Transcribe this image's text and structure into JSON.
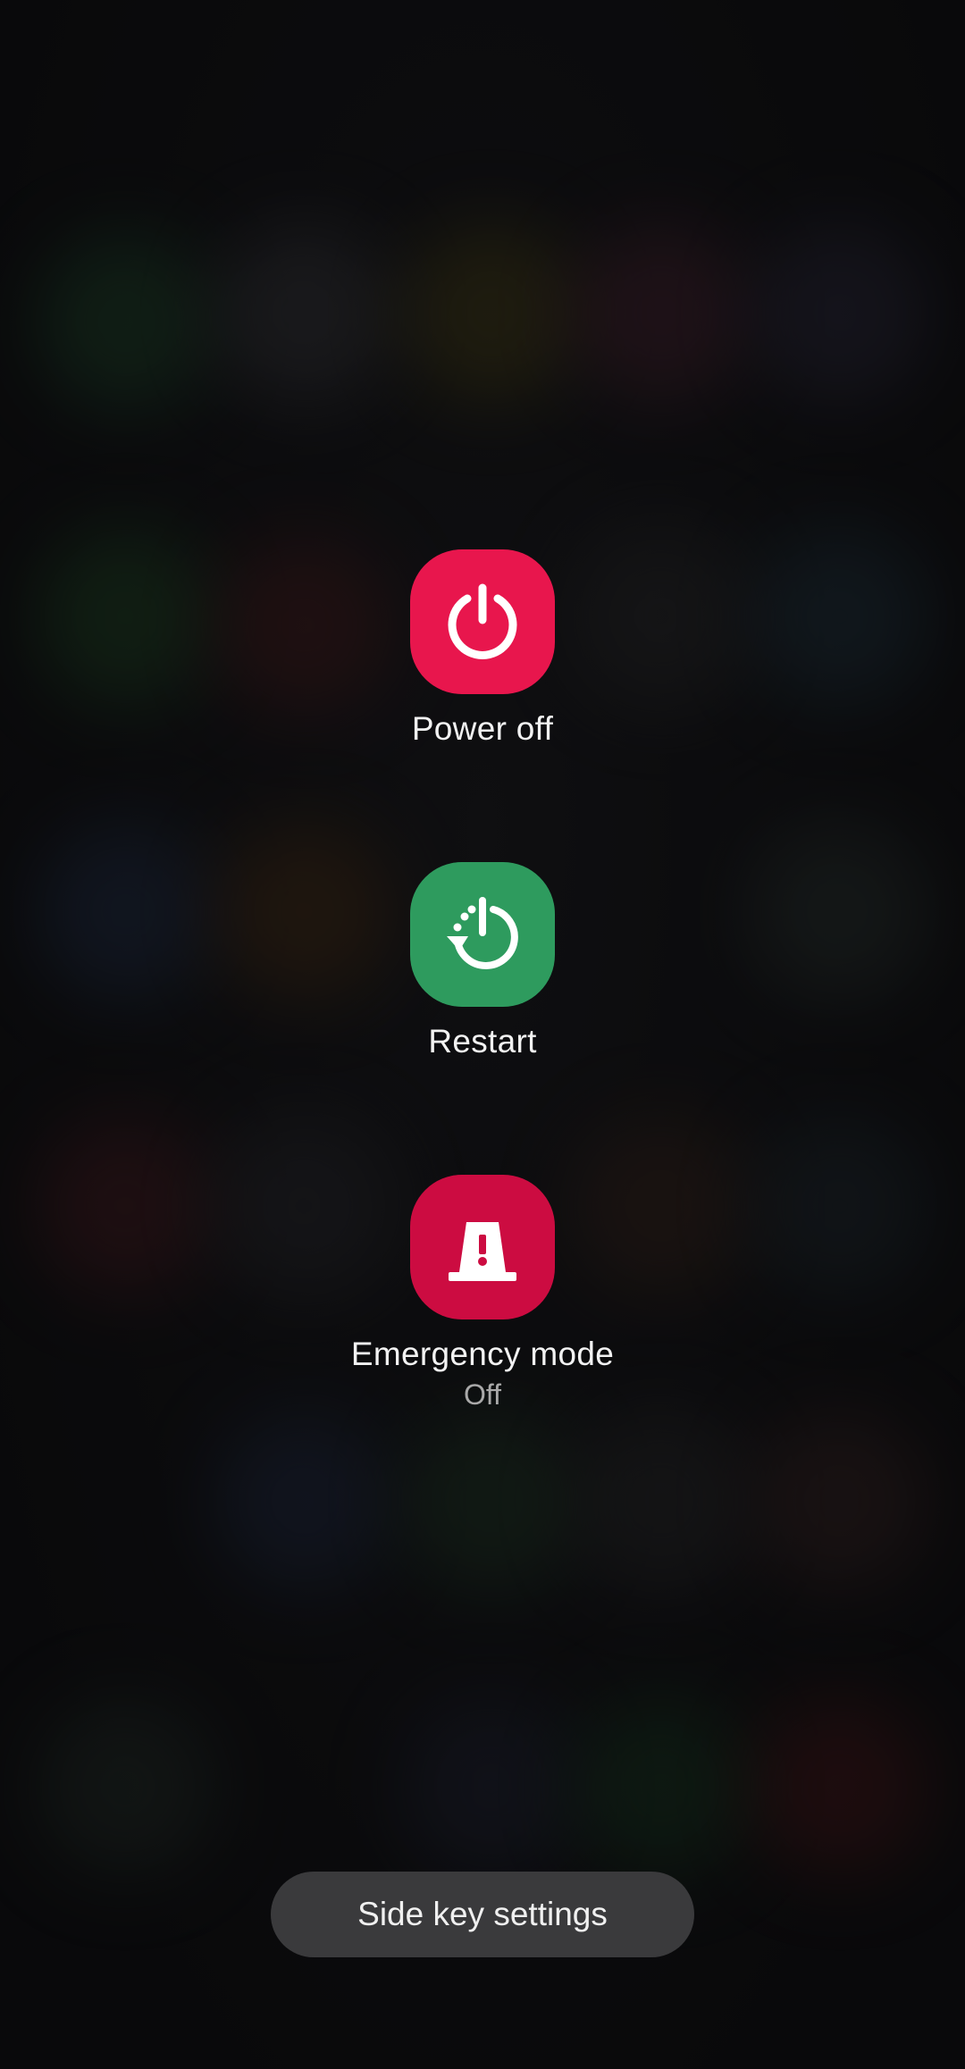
{
  "power_menu": {
    "items": [
      {
        "id": "power_off",
        "label": "Power off",
        "icon": "power-icon",
        "color": "#e8164d"
      },
      {
        "id": "restart",
        "label": "Restart",
        "icon": "restart-icon",
        "color": "#2e9b5e"
      },
      {
        "id": "emergency_mode",
        "label": "Emergency mode",
        "sublabel": "Off",
        "icon": "emergency-beacon-icon",
        "color": "#cc0c41"
      }
    ]
  },
  "side_key_button": {
    "label": "Side key settings"
  }
}
